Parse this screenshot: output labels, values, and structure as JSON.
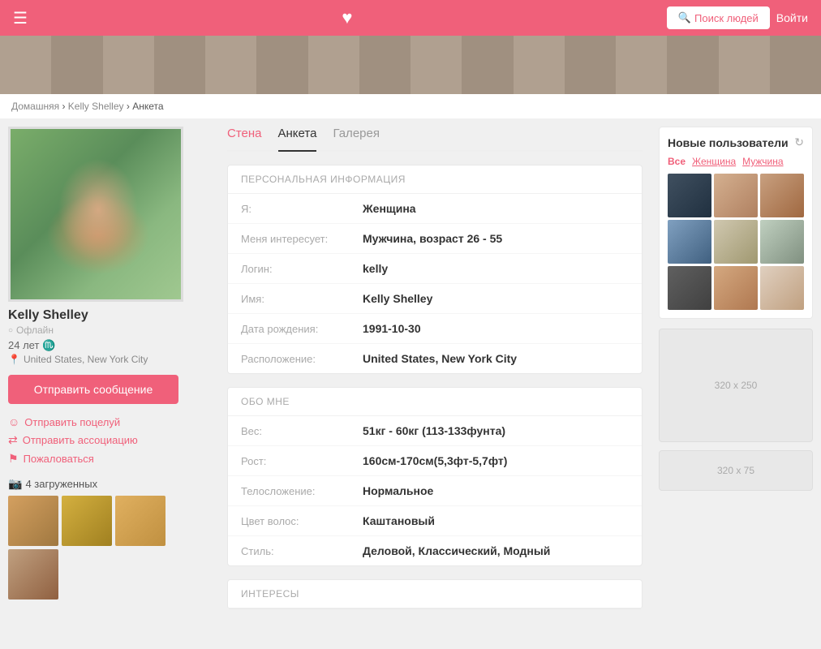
{
  "header": {
    "heart_icon": "♥",
    "search_btn_label": "Поиск людей",
    "login_btn_label": "Войти",
    "menu_icon": "☰",
    "search_icon": "🔍"
  },
  "breadcrumb": {
    "home": "Домашняя",
    "name": "Kelly Shelley",
    "page": "Анкета",
    "separator": "›"
  },
  "profile": {
    "name": "Kelly Shelley",
    "status": "Офлайн",
    "age": "24 лет",
    "zodiac": "♏",
    "location": "United States, New York City",
    "send_message": "Отправить сообщение",
    "action_kiss": "Отправить поцелуй",
    "action_assoc": "Отправить ассоциацию",
    "action_report": "Пожаловаться",
    "uploads_label": "4 загруженных"
  },
  "tabs": {
    "wall": "Стена",
    "profile": "Анкета",
    "gallery": "Галерея"
  },
  "personal_info": {
    "section_title": "ПЕРСОНАЛЬНАЯ ИНФОРМАЦИЯ",
    "fields": [
      {
        "label": "Я:",
        "value": "Женщина"
      },
      {
        "label": "Меня интересует:",
        "value": "Мужчина, возраст 26 - 55"
      },
      {
        "label": "Логин:",
        "value": "kelly"
      },
      {
        "label": "Имя:",
        "value": "Kelly Shelley"
      },
      {
        "label": "Дата рождения:",
        "value": "1991-10-30"
      },
      {
        "label": "Расположение:",
        "value": "United States, New York City"
      }
    ]
  },
  "about_me": {
    "section_title": "ОБО МНЕ",
    "fields": [
      {
        "label": "Вес:",
        "value": "51кг - 60кг (113-133фунта)"
      },
      {
        "label": "Рост:",
        "value": "160см-170см(5,3фт-5,7фт)"
      },
      {
        "label": "Телосложение:",
        "value": "Нормальное"
      },
      {
        "label": "Цвет волос:",
        "value": "Каштановый"
      },
      {
        "label": "Стиль:",
        "value": "Деловой, Классический, Модный"
      }
    ]
  },
  "interests": {
    "section_title": "ИНТЕРЕСЫ"
  },
  "new_users": {
    "title": "Новые пользователи",
    "refresh_icon": "↻",
    "filters": [
      "Все",
      "Женщина",
      "Мужчина"
    ]
  },
  "ads": {
    "large": "320 x 250",
    "small": "320 x 75"
  },
  "photo_strip_count": 16
}
